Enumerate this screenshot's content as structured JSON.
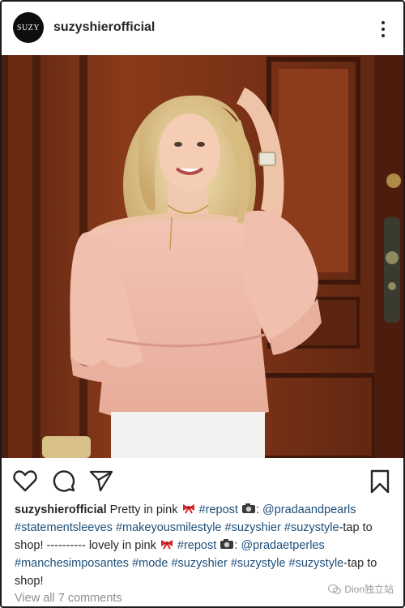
{
  "header": {
    "avatar_text": "SUZY",
    "username": "suzyshierofficial",
    "more_icon": "more-vertical-icon"
  },
  "photo": {
    "alt_icon": "post-photo"
  },
  "actions": {
    "like_icon": "heart-icon",
    "comment_icon": "comment-icon",
    "share_icon": "send-icon",
    "save_icon": "bookmark-icon"
  },
  "caption": {
    "username": "suzyshierofficial",
    "text1": "Pretty in pink",
    "tag_repost1": "#repost",
    "colon1": ":",
    "mention1": "@pradaandpearls",
    "tag_statementsleeves": "#statementsleeves",
    "tag_makeyousmilestyle": "#makeyousmilestyle",
    "tag_suzyshier1": "#suzyshier",
    "tag_suzystyle1": "#suzystyle",
    "text2": "-tap to shop! ---------- lovely in pink",
    "tag_repost2": "#repost",
    "colon2": ":",
    "mention2": "@pradaetperles",
    "tag_manchesimposantes": "#manchesimposantes",
    "tag_mode": "#mode",
    "tag_suzyshier2": "#suzyshier",
    "tag_suzystyle2": "#suzystyle",
    "tag_suzystyle3": "#suzystyle",
    "text3": "-tap to shop!"
  },
  "comments": {
    "label": "View all 7 comments"
  },
  "watermark": {
    "text": "Dion独立站"
  },
  "colors": {
    "hashtag": "#1e4e79",
    "text": "#262626",
    "muted": "#8e8e8e"
  }
}
